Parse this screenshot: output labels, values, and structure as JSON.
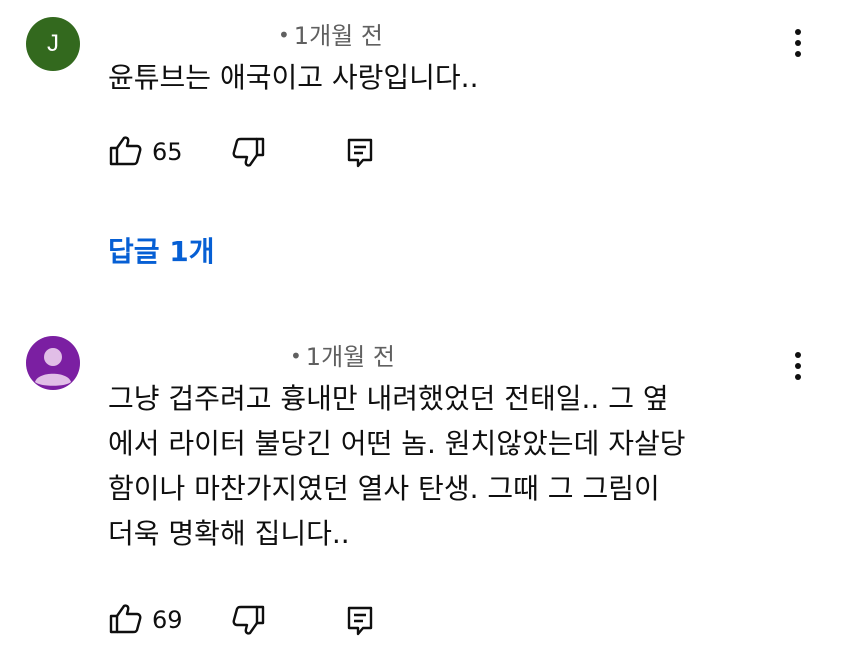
{
  "comments": [
    {
      "avatar_letter": "J",
      "avatar_color": "#33691e",
      "time": "1개월 전",
      "text": "윤튜브는 애국이고 사랑입니다..",
      "likes": "65"
    },
    {
      "avatar_color": "#7b1fa2",
      "time": "1개월 전",
      "text": "그냥 겁주려고 흉내만 내려했었던 전태일..   그 옆\n에서 라이터 불당긴 어떤 놈.   원치않았는데 자살당\n함이나 마찬가지였던 열사 탄생.   그때 그 그림이\n더욱 명확해 집니다..",
      "likes": "69"
    }
  ],
  "replies_label": "답글 1개",
  "accent_color": "#065fd4"
}
